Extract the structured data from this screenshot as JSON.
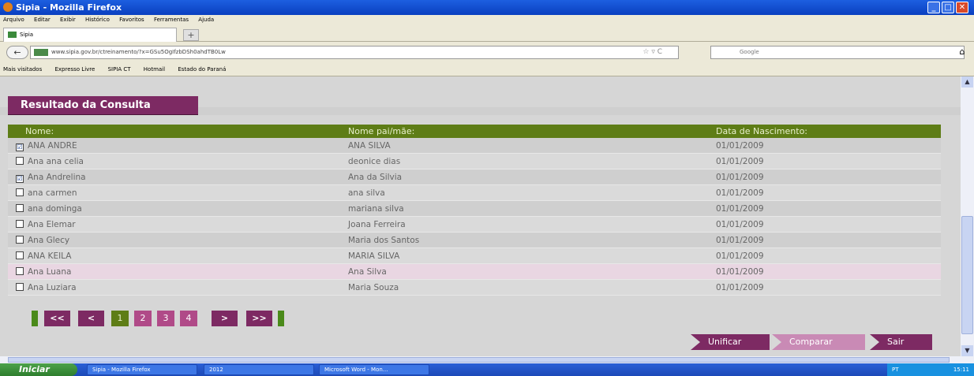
{
  "window": {
    "title": "Sipia - Mozilla Firefox",
    "controls": [
      "_",
      "□",
      "✕"
    ]
  },
  "menu": [
    "Arquivo",
    "Editar",
    "Exibir",
    "Histórico",
    "Favoritos",
    "Ferramentas",
    "Ajuda"
  ],
  "tab": {
    "label": "Sipia",
    "newtab": "+"
  },
  "nav": {
    "url": "www.sipia.gov.br/ctreinamento/?x=GSu5OgIfzbDSh0ahdTB0Lw",
    "search_placeholder": "Google",
    "back": "←",
    "home": "⌂",
    "star": "☆ ▿ C"
  },
  "bookmarks": [
    "Mais visitados",
    "Expresso Livre",
    "SIPIA CT",
    "Hotmail",
    "Estado do Paraná"
  ],
  "page": {
    "section_title": "Resultado da Consulta",
    "columns": [
      "Nome:",
      "Nome pai/mãe:",
      "Data de Nascimento:"
    ],
    "rows": [
      {
        "nome": "ANA ANDRE",
        "pai_mae": "ANA SILVA",
        "nasc": "01/01/2009",
        "checked": "☑"
      },
      {
        "nome": "Ana ana celia",
        "pai_mae": "deonice dias",
        "nasc": "01/01/2009",
        "checked": ""
      },
      {
        "nome": "Ana Andrelina",
        "pai_mae": "Ana da Silvia",
        "nasc": "01/01/2009",
        "checked": "☑"
      },
      {
        "nome": "ana carmen",
        "pai_mae": "ana silva",
        "nasc": "01/01/2009",
        "checked": ""
      },
      {
        "nome": "ana dominga",
        "pai_mae": "mariana silva",
        "nasc": "01/01/2009",
        "checked": ""
      },
      {
        "nome": "Ana Elemar",
        "pai_mae": "Joana Ferreira",
        "nasc": "01/01/2009",
        "checked": ""
      },
      {
        "nome": "Ana Glecy",
        "pai_mae": "Maria dos Santos",
        "nasc": "01/01/2009",
        "checked": ""
      },
      {
        "nome": "ANA KEILA",
        "pai_mae": "MARIA SILVA",
        "nasc": "01/01/2009",
        "checked": ""
      },
      {
        "nome": "Ana Luana",
        "pai_mae": "Ana Silva",
        "nasc": "01/01/2009",
        "checked": ""
      },
      {
        "nome": "Ana Luziara",
        "pai_mae": "Maria Souza",
        "nasc": "01/01/2009",
        "checked": ""
      }
    ],
    "pagination": {
      "first": "<<",
      "prev": "<",
      "pages": [
        "1",
        "2",
        "3",
        "4"
      ],
      "current": "1",
      "next": ">",
      "last": ">>"
    },
    "buttons": {
      "unificar": "Unificar",
      "comparar": "Comparar",
      "sair": "Sair"
    }
  },
  "taskbar": {
    "start": "Iniciar",
    "items": [
      "Sipia - Mozilla Firefox",
      "2012",
      "Microsoft Word - Mon..."
    ],
    "tray_lang": "PT",
    "clock": "15:11"
  },
  "colors": {
    "accent": "#7d2a63",
    "header_green": "#5e7d16"
  }
}
